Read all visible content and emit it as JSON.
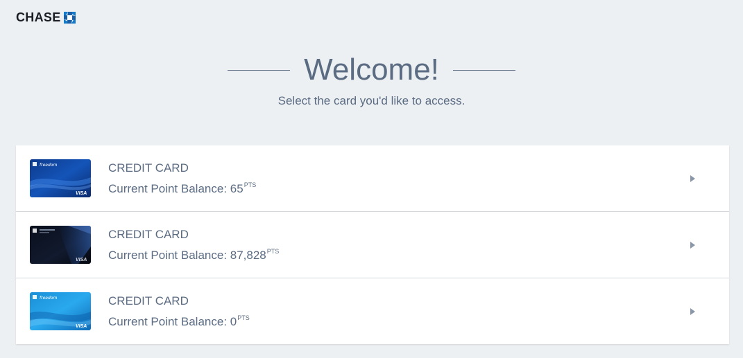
{
  "brand": {
    "name": "CHASE"
  },
  "welcome": {
    "title": "Welcome!",
    "subtitle": "Select the card you'd like to access."
  },
  "cards": [
    {
      "type": "CREDIT CARD",
      "balance_label": "Current Point Balance: ",
      "balance": "65",
      "unit": "PTS",
      "card_art": "freedom-unlimited",
      "card_brand_text": "freedom",
      "network": "VISA"
    },
    {
      "type": "CREDIT CARD",
      "balance_label": "Current Point Balance: ",
      "balance": "87,828",
      "unit": "PTS",
      "card_art": "sapphire-reserve",
      "card_brand_text": "",
      "network": "VISA"
    },
    {
      "type": "CREDIT CARD",
      "balance_label": "Current Point Balance: ",
      "balance": "0",
      "unit": "PTS",
      "card_art": "freedom",
      "card_brand_text": "freedom",
      "network": "VISA"
    }
  ],
  "icons": {
    "logo": "chase-octagon-icon",
    "row_arrow": "chevron-right-icon"
  },
  "colors": {
    "background": "#edf0f3",
    "text": "#5a6b82",
    "chase_blue": "#117aca"
  }
}
